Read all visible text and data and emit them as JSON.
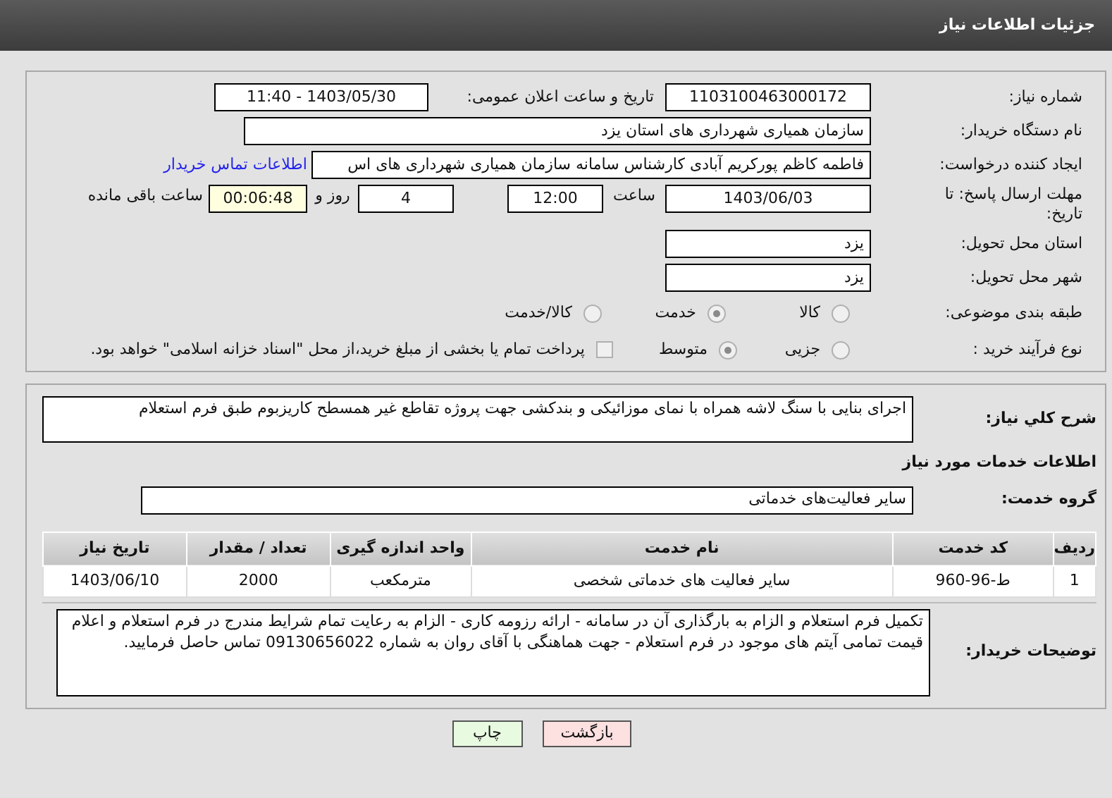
{
  "header": {
    "title": "جزئیات اطلاعات نیاز"
  },
  "need_number": {
    "label": "شماره نیاز:",
    "value": "1103100463000172"
  },
  "announce": {
    "label": "تاریخ و ساعت اعلان عمومی:",
    "value": "1403/05/30 - 11:40"
  },
  "buyer_org": {
    "label": "نام دستگاه خریدار:",
    "value": "سازمان همیاری شهرداری های استان یزد"
  },
  "creator": {
    "label": "ایجاد کننده درخواست:",
    "value": "فاطمه کاظم پورکریم آبادی کارشناس سامانه سازمان همیاری شهرداری های اس",
    "link": "اطلاعات تماس خریدار"
  },
  "deadline": {
    "label": "مهلت ارسال پاسخ: تا تاریخ:",
    "date": "1403/06/03",
    "time_label": "ساعت",
    "time": "12:00",
    "days": "4",
    "days_suffix": "روز و",
    "remaining": "00:06:48",
    "remaining_suffix": "ساعت باقی مانده"
  },
  "province": {
    "label": "استان محل تحویل:",
    "value": "یزد"
  },
  "city": {
    "label": "شهر محل تحویل:",
    "value": "یزد"
  },
  "category": {
    "label": "طبقه بندی موضوعی:",
    "options": [
      {
        "label": "کالا",
        "selected": false
      },
      {
        "label": "خدمت",
        "selected": true
      },
      {
        "label": "کالا/خدمت",
        "selected": false
      }
    ]
  },
  "process": {
    "label": "نوع فرآیند خرید :",
    "options": [
      {
        "label": "جزیی",
        "selected": false
      },
      {
        "label": "متوسط",
        "selected": true
      }
    ],
    "checkbox": {
      "label": "پرداخت تمام یا بخشی از مبلغ خرید،از محل \"اسناد خزانه اسلامی\" خواهد بود.",
      "checked": false
    }
  },
  "description": {
    "label": "شرح کلي نياز:",
    "value": "اجرای بنایی با سنگ لاشه همراه با نمای موزائیکی و بندکشی جهت پروژه تقاطع غیر همسطح کاریزبوم طبق فرم استعلام"
  },
  "services_title": "اطلاعات خدمات مورد نياز",
  "service_group": {
    "label": "گروه خدمت:",
    "value": "سایر فعالیت‌های خدماتی"
  },
  "table": {
    "columns": [
      "ردیف",
      "کد خدمت",
      "نام خدمت",
      "واحد اندازه گیری",
      "تعداد / مقدار",
      "تاریخ نیاز"
    ],
    "rows": [
      [
        "1",
        "ط-96-960",
        "سایر فعالیت های خدماتی شخصی",
        "مترمکعب",
        "2000",
        "1403/06/10"
      ]
    ]
  },
  "buyer_notes": {
    "label": "توضیحات خریدار:",
    "value": "تکمیل فرم استعلام و الزام به بارگذاری آن در سامانه - ارائه رزومه کاری - الزام به رعایت تمام شرایط مندرج در فرم استعلام و اعلام قیمت تمامی آیتم های موجود در فرم استعلام - جهت هماهنگی با آقای روان به شماره 09130656022 تماس حاصل فرمایید."
  },
  "buttons": [
    {
      "label": "بازگشت",
      "kind": "back"
    },
    {
      "label": "چاپ",
      "kind": "print"
    }
  ]
}
